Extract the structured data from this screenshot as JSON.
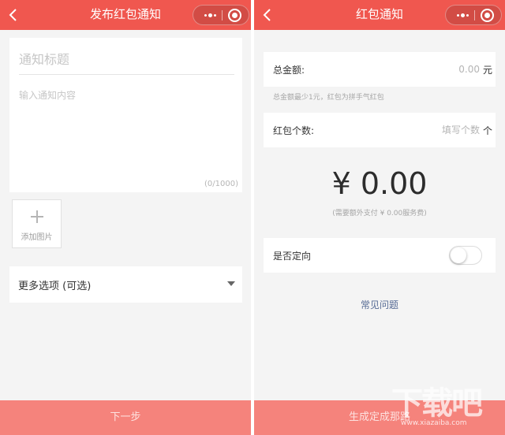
{
  "colors": {
    "brand_red": "#f0574f",
    "button_red": "#f5837c",
    "link_blue": "#576b95",
    "page_bg": "#f4f4f4"
  },
  "icons": {
    "back": "back-chevron-icon",
    "more": "more-dots-icon",
    "close": "close-target-icon",
    "add": "plus-icon",
    "dropdown": "caret-down-icon"
  },
  "left": {
    "nav_title": "发布红包通知",
    "title_placeholder": "通知标题",
    "content_placeholder": "输入通知内容",
    "char_counter": "(0/1000)",
    "add_image_label": "添加图片",
    "more_options_label": "更多选项 (可选)",
    "next_button": "下一步"
  },
  "right": {
    "nav_title": "红包通知",
    "total_label": "总金额:",
    "total_value": "0.00",
    "total_unit": "元",
    "total_hint": "总金额最少1元，红包为拼手气红包",
    "count_label": "红包个数:",
    "count_placeholder": "填写个数",
    "count_unit": "个",
    "amount_display": "¥ 0.00",
    "fee_note": "(需要额外支付 ¥ 0.00服务费)",
    "targeted_label": "是否定向",
    "targeted_on": false,
    "faq_link": "常见问题",
    "generate_button": "生成定成那路"
  },
  "watermark": {
    "text": "下载吧",
    "url": "www.xiazaiba.com"
  }
}
